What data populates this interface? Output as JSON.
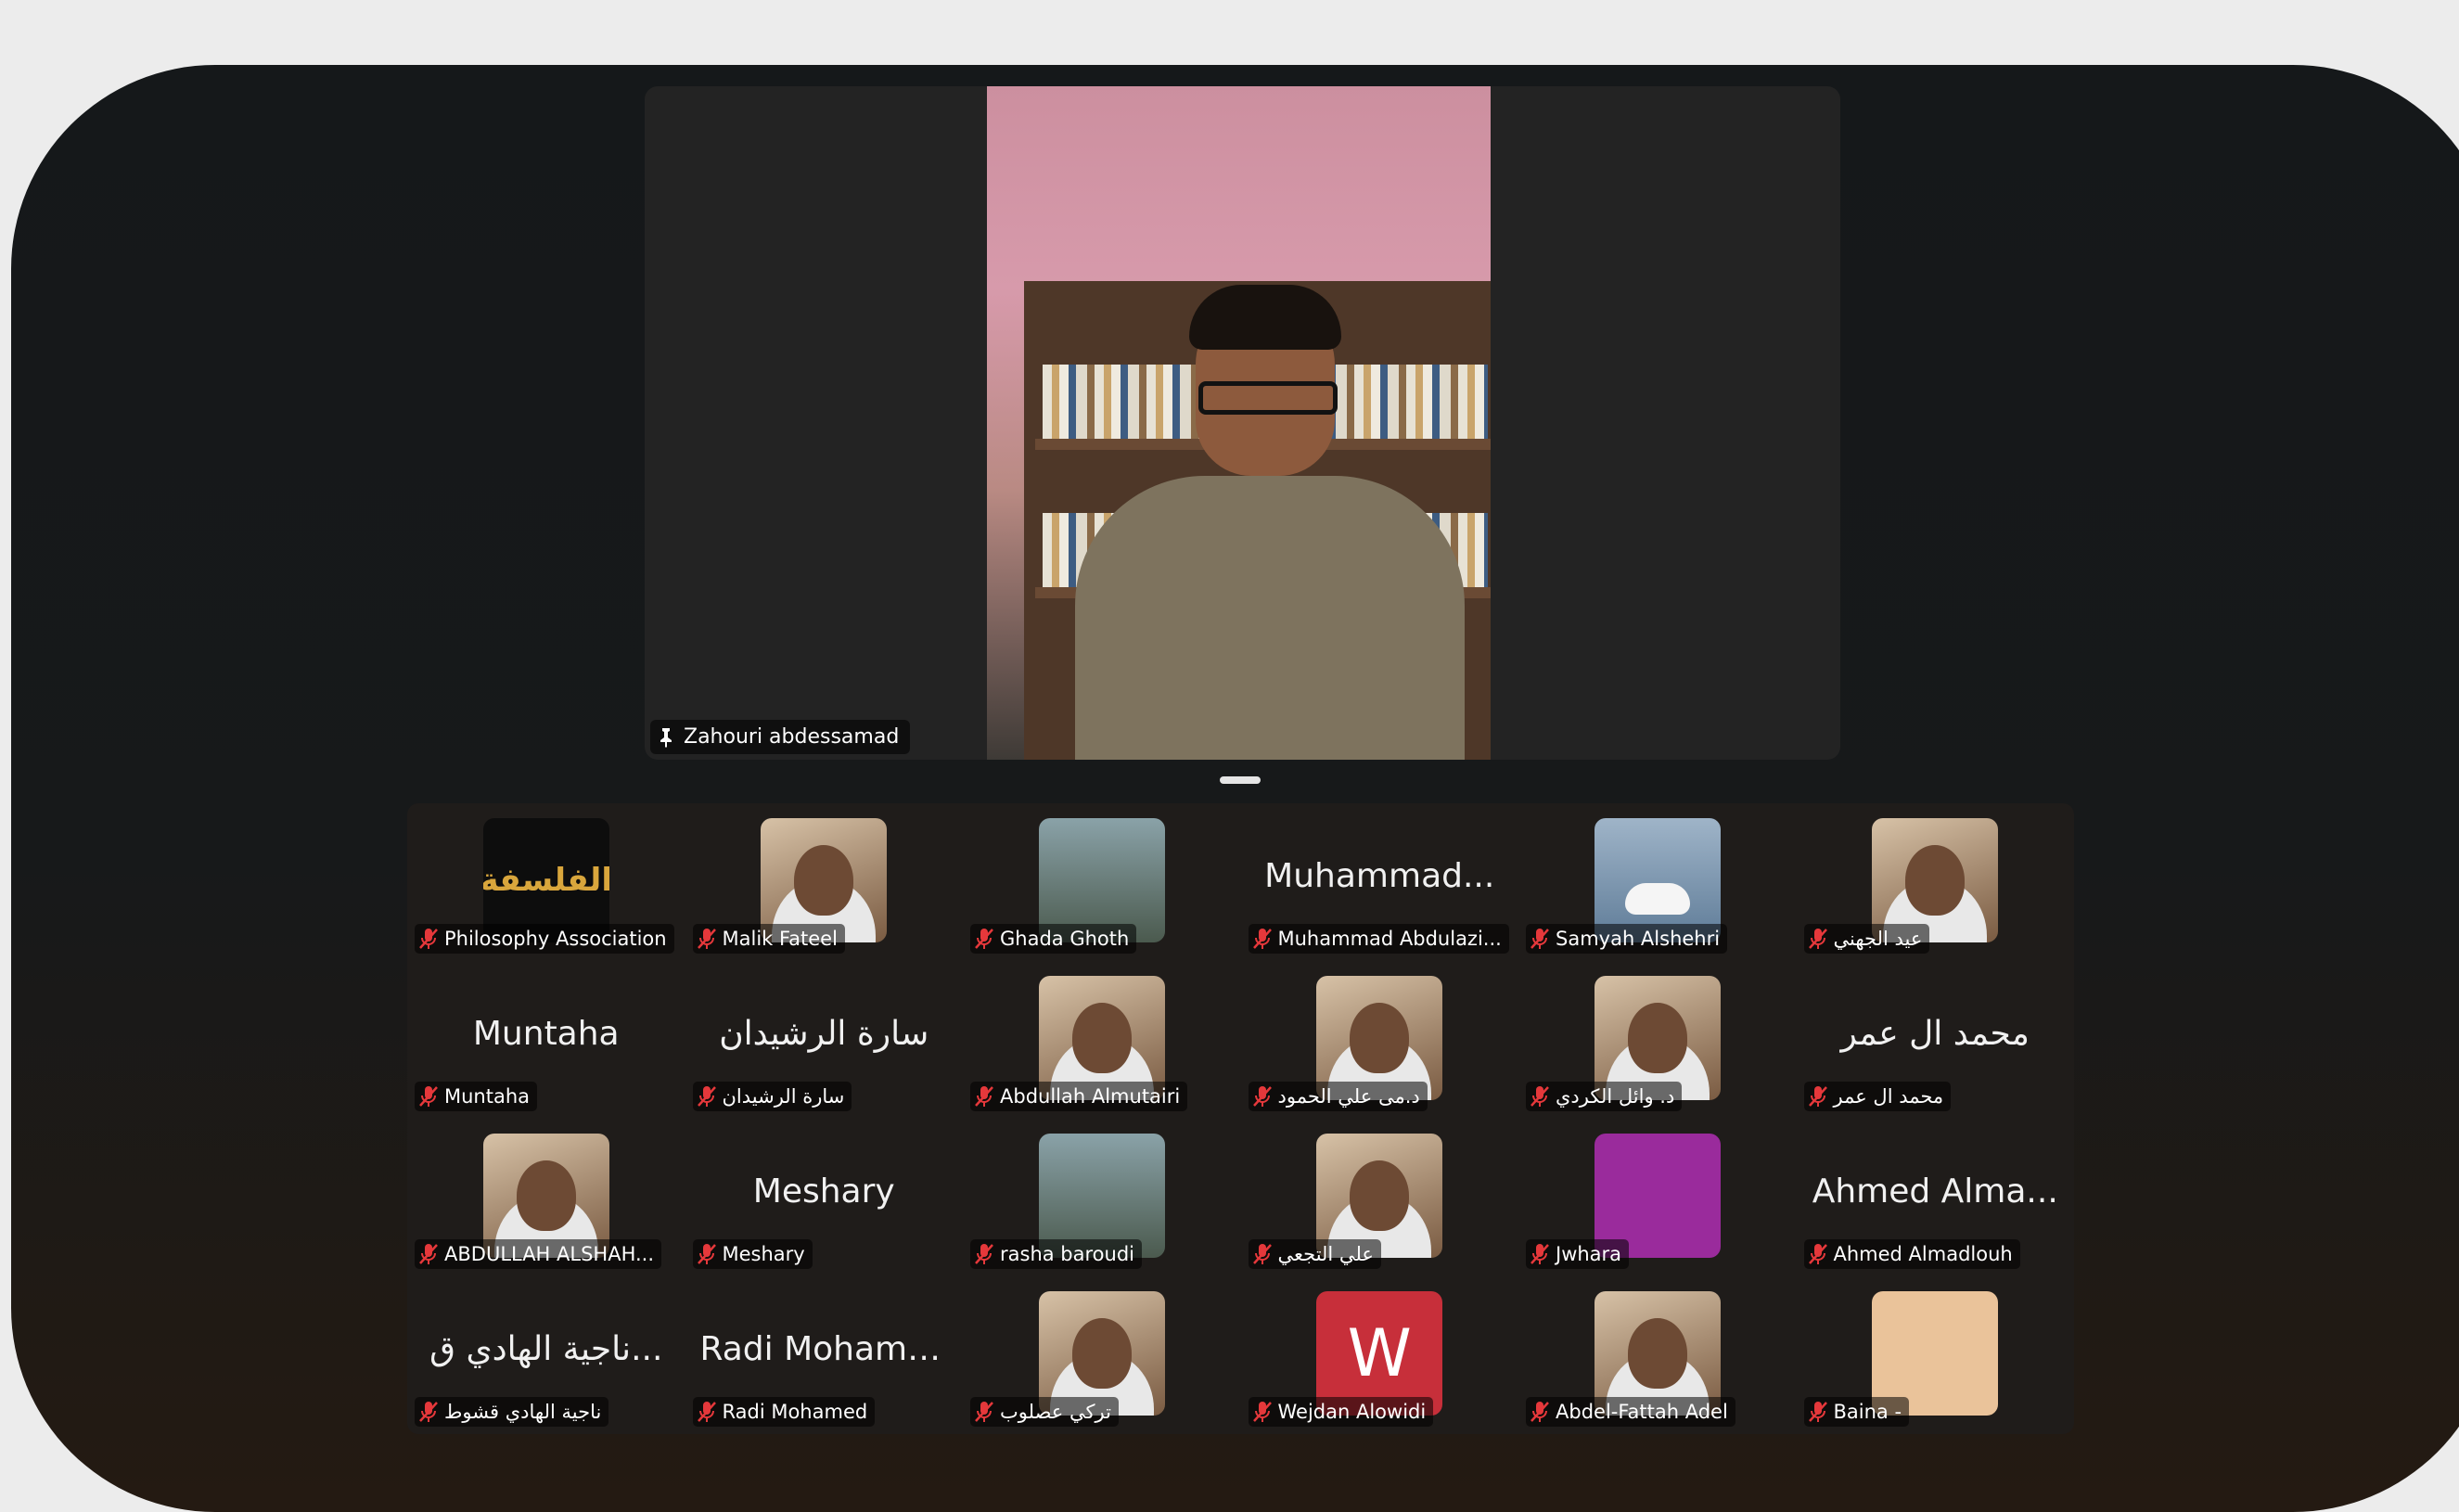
{
  "speaker": {
    "name": "Zahouri abdessamad"
  },
  "participants": [
    {
      "label": "Philosophy Association",
      "avatar": "logo",
      "avatar_text": "الفلسفة"
    },
    {
      "label": "Malik Fateel",
      "avatar": "photo"
    },
    {
      "label": "Ghada Ghoth",
      "avatar": "nature"
    },
    {
      "label": "Muhammad Abdulazi...",
      "big": "Muhammad..."
    },
    {
      "label": "Samyah Alshehri",
      "avatar": "swan"
    },
    {
      "label": "عيد الجهني",
      "avatar": "photo"
    },
    {
      "label": "Muntaha",
      "big": "Muntaha"
    },
    {
      "label": "سارة الرشيدان",
      "big": "سارة الرشيدان"
    },
    {
      "label": "Abdullah Almutairi",
      "avatar": "photo"
    },
    {
      "label": "د.مى علي الحمود",
      "avatar": "photo"
    },
    {
      "label": "د. وائل الكردي",
      "avatar": "photo"
    },
    {
      "label": "محمد ال عمر",
      "big": "محمد ال عمر"
    },
    {
      "label": "ABDULLAH ALSHAH...",
      "avatar": "photo"
    },
    {
      "label": "Meshary",
      "big": "Meshary"
    },
    {
      "label": "rasha baroudi",
      "avatar": "nature"
    },
    {
      "label": "علي التجعي",
      "avatar": "photo"
    },
    {
      "label": "Jwhara",
      "avatar": "purple"
    },
    {
      "label": "Ahmed Almadlouh",
      "big": "Ahmed Alma..."
    },
    {
      "label": "ناجية الهادي قشوط",
      "big": "ناجية الهادي ق..."
    },
    {
      "label": "Radi Mohamed",
      "big": "Radi Mohamed"
    },
    {
      "label": "تركي عصلوب",
      "avatar": "photo"
    },
    {
      "label": "Wejdan Alowidi",
      "avatar": "red",
      "avatar_text": "W"
    },
    {
      "label": "Abdel-Fattah Adel",
      "avatar": "photo"
    },
    {
      "label": "Baina -",
      "avatar": "cream"
    }
  ]
}
